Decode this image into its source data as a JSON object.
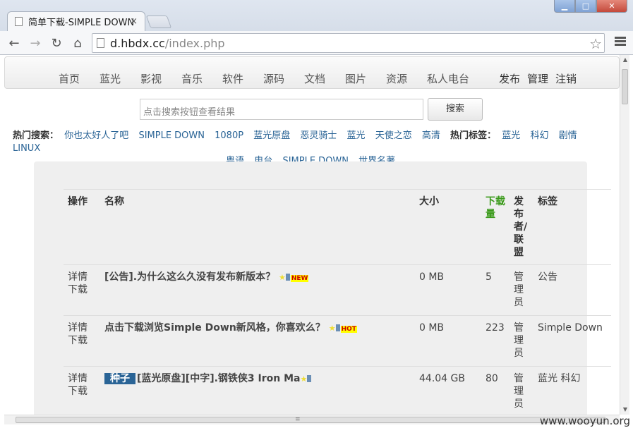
{
  "browser": {
    "tab_title": "简单下载-SIMPLE DOWN",
    "tab_close": "×",
    "url_host": "d.hbdx.cc",
    "url_path": "/index.php"
  },
  "nav": {
    "items": [
      "首页",
      "蓝光",
      "影视",
      "音乐",
      "软件",
      "源码",
      "文档",
      "图片",
      "资源",
      "私人电台"
    ],
    "right": [
      "发布",
      "管理",
      "注销"
    ]
  },
  "search": {
    "placeholder": "点击搜索按钮查看结果",
    "button": "搜索"
  },
  "hot_search": {
    "label": "热门搜索：",
    "items": [
      "你也太好人了吧",
      "SIMPLE DOWN",
      "1080P",
      "蓝光原盘",
      "恶灵骑士",
      "蓝光",
      "天使之恋",
      "高清"
    ],
    "tag_label": "热门标签：",
    "tags": [
      "蓝光",
      "科幻",
      "剧情",
      "LINUX",
      "粤语",
      "电台",
      "SIMPLE DOWN",
      "世界名著"
    ]
  },
  "table": {
    "headers": [
      "操作",
      "名称",
      "大小",
      "下载量",
      "发布者/联盟",
      "标签"
    ],
    "rows": [
      {
        "op": "详情 下载",
        "name": "[公告].为什么这么久没有发布新版本？",
        "badge": "NEW",
        "size": "0 MB",
        "dl": "5",
        "pub": "管理员",
        "tag": "公告"
      },
      {
        "op": "详情 下载",
        "name": "点击下载浏览Simple Down新风格，你喜欢么？",
        "badge": "HOT",
        "size": "0 MB",
        "dl": "223",
        "pub": "管理员",
        "tag": "Simple Down"
      },
      {
        "op": "详情 下载",
        "seed": "种子",
        "name": "[蓝光原盘][中字].钢铁侠3 Iron Ma",
        "badge": "",
        "size": "44.04 GB",
        "dl": "80",
        "pub": "管理员",
        "tag": "蓝光  科幻"
      }
    ]
  },
  "watermark": "www.wooyun.org",
  "colors": {
    "link": "#2a6496",
    "download_header": "#3a9a1a"
  }
}
